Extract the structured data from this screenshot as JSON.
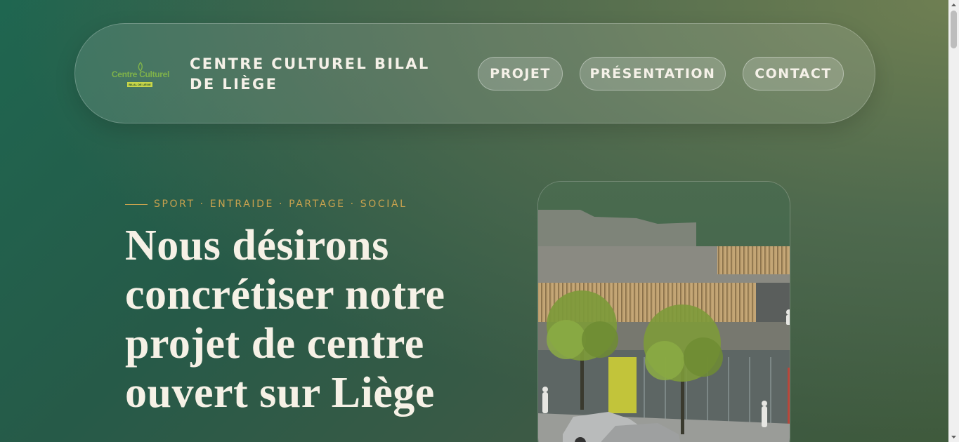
{
  "header": {
    "logo": {
      "name": "Centre Culturel",
      "subtext": "BILAL DE LIÈGE"
    },
    "site_title": "CENTRE CULTUREL BILAL DE LIÈGE",
    "nav": [
      {
        "label": "PROJET"
      },
      {
        "label": "PRÉSENTATION"
      },
      {
        "label": "CONTACT"
      }
    ]
  },
  "hero": {
    "tagline": "SPORT · ENTRAIDE · PARTAGE · SOCIAL",
    "title": "Nous désirons concrétiser notre projet de centre ouvert sur Liège"
  },
  "colors": {
    "accent_gold": "#c9a24e",
    "logo_green": "#7fb24a",
    "text_light": "#f5f1e8"
  },
  "icons": {
    "scroll_up": "triangle-up",
    "scroll_down": "triangle-down"
  }
}
